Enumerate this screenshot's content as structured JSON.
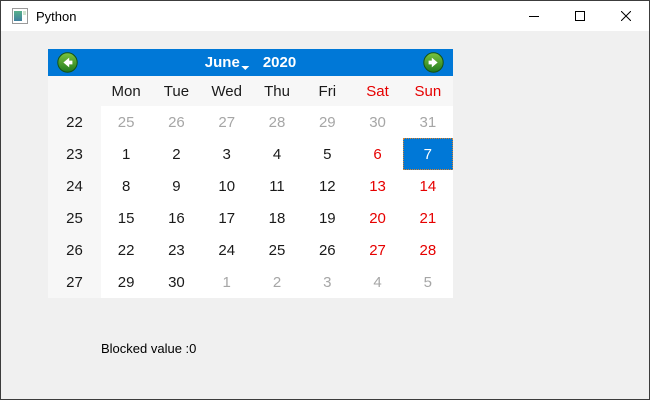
{
  "window": {
    "title": "Python",
    "icon": "app-window-icon",
    "controls": [
      {
        "name": "minimize"
      },
      {
        "name": "maximize"
      },
      {
        "name": "close"
      }
    ]
  },
  "calendar": {
    "nav": {
      "month": "June",
      "year": "2020",
      "prev_icon": "prev-month-arrow",
      "next_icon": "next-month-arrow"
    },
    "day_headers": [
      {
        "text": "Mon",
        "style": "weekday"
      },
      {
        "text": "Tue",
        "style": "weekday"
      },
      {
        "text": "Wed",
        "style": "weekday"
      },
      {
        "text": "Thu",
        "style": "weekday"
      },
      {
        "text": "Fri",
        "style": "weekday"
      },
      {
        "text": "Sat",
        "style": "weekend"
      },
      {
        "text": "Sun",
        "style": "weekend"
      }
    ],
    "weeks": [
      {
        "num": "22",
        "days": [
          {
            "t": "25",
            "s": "muted"
          },
          {
            "t": "26",
            "s": "muted"
          },
          {
            "t": "27",
            "s": "muted"
          },
          {
            "t": "28",
            "s": "muted"
          },
          {
            "t": "29",
            "s": "muted"
          },
          {
            "t": "30",
            "s": "muted"
          },
          {
            "t": "31",
            "s": "muted"
          }
        ]
      },
      {
        "num": "23",
        "days": [
          {
            "t": "1",
            "s": "normal"
          },
          {
            "t": "2",
            "s": "normal"
          },
          {
            "t": "3",
            "s": "normal"
          },
          {
            "t": "4",
            "s": "normal"
          },
          {
            "t": "5",
            "s": "normal"
          },
          {
            "t": "6",
            "s": "weekend"
          },
          {
            "t": "7",
            "s": "selected"
          }
        ]
      },
      {
        "num": "24",
        "days": [
          {
            "t": "8",
            "s": "normal"
          },
          {
            "t": "9",
            "s": "normal"
          },
          {
            "t": "10",
            "s": "normal"
          },
          {
            "t": "11",
            "s": "normal"
          },
          {
            "t": "12",
            "s": "normal"
          },
          {
            "t": "13",
            "s": "weekend"
          },
          {
            "t": "14",
            "s": "weekend"
          }
        ]
      },
      {
        "num": "25",
        "days": [
          {
            "t": "15",
            "s": "normal"
          },
          {
            "t": "16",
            "s": "normal"
          },
          {
            "t": "17",
            "s": "normal"
          },
          {
            "t": "18",
            "s": "normal"
          },
          {
            "t": "19",
            "s": "normal"
          },
          {
            "t": "20",
            "s": "weekend"
          },
          {
            "t": "21",
            "s": "weekend"
          }
        ]
      },
      {
        "num": "26",
        "days": [
          {
            "t": "22",
            "s": "normal"
          },
          {
            "t": "23",
            "s": "normal"
          },
          {
            "t": "24",
            "s": "normal"
          },
          {
            "t": "25",
            "s": "normal"
          },
          {
            "t": "26",
            "s": "normal"
          },
          {
            "t": "27",
            "s": "weekend"
          },
          {
            "t": "28",
            "s": "weekend"
          }
        ]
      },
      {
        "num": "27",
        "days": [
          {
            "t": "29",
            "s": "normal"
          },
          {
            "t": "30",
            "s": "normal"
          },
          {
            "t": "1",
            "s": "muted"
          },
          {
            "t": "2",
            "s": "muted"
          },
          {
            "t": "3",
            "s": "muted"
          },
          {
            "t": "4",
            "s": "muted"
          },
          {
            "t": "5",
            "s": "muted"
          }
        ]
      }
    ],
    "selected_date": "7"
  },
  "footer": {
    "blocked_label": "Blocked value :0"
  },
  "colors": {
    "accent": "#0078d7",
    "weekend": "#e60000",
    "muted": "#a6a6a6",
    "focus_dots": "#d9822b",
    "panel_gray": "#f7f7f7",
    "window_bg": "#f0f0f0",
    "nav_green_light": "#7cc43e",
    "nav_green_dark": "#1f7a1f"
  }
}
